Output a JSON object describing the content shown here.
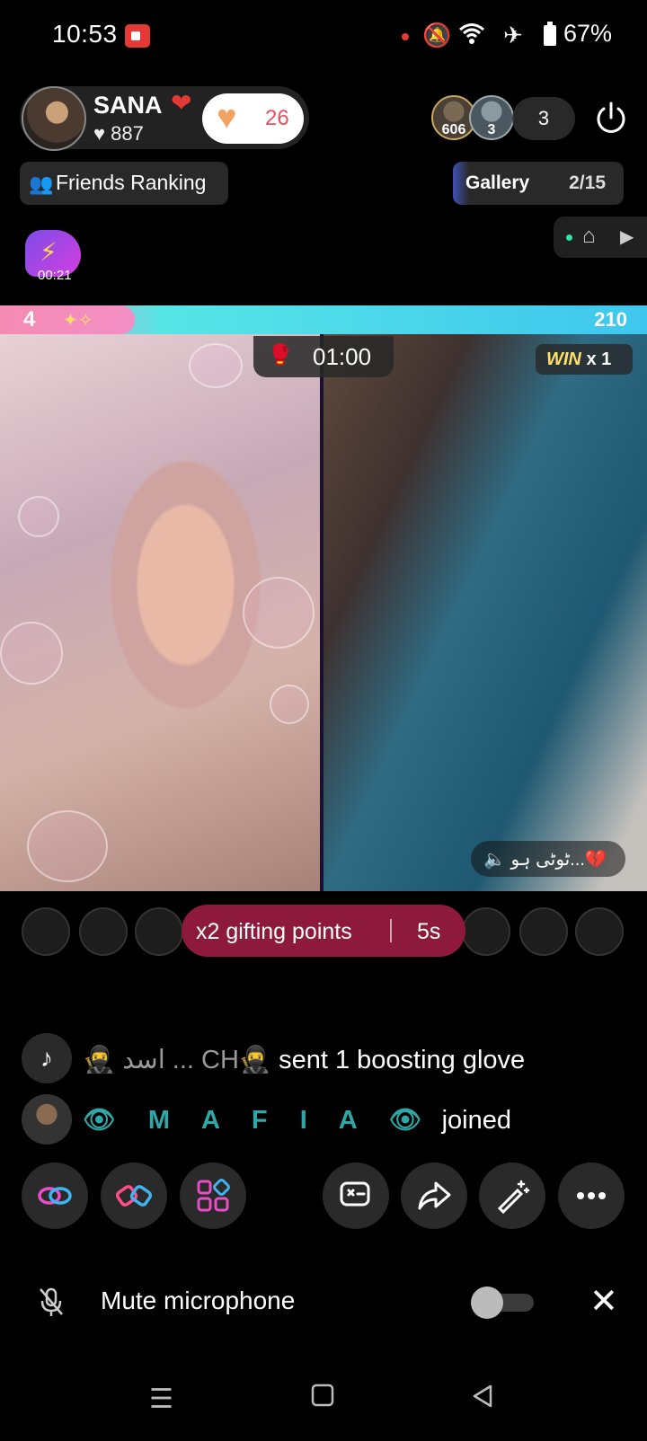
{
  "status_bar": {
    "time": "10:53",
    "battery": "67%"
  },
  "host": {
    "name": "SANA",
    "heart": "❤",
    "likes": "♥ 887",
    "like_count": "26"
  },
  "viewers": {
    "badge1": "606",
    "badge2": "3",
    "count": "3"
  },
  "friends_ranking": {
    "label": "Friends Ranking"
  },
  "gallery": {
    "label": "Gallery",
    "page": "2/15"
  },
  "event": {
    "timer": "00:21"
  },
  "battle": {
    "left_score": "4",
    "right_score": "210",
    "countdown": "01:00",
    "win_label": "WIN",
    "win_count": "x 1"
  },
  "song": {
    "text": "ٹوٹی ہو...💔"
  },
  "gifting": {
    "text": "x2 gifting points",
    "seconds": "5s"
  },
  "chat": [
    {
      "sender": "🥷 اسد ... CH🥷",
      "action": "sent 1 boosting glove"
    },
    {
      "sender": "👁 M A F I A 👁",
      "action": "joined"
    }
  ],
  "mute": {
    "label": "Mute microphone"
  },
  "colors": {
    "accent_pink": "#ee4d5f",
    "gift_banner": "#8d1a3c",
    "battle_blue": "#3fc6ee",
    "battle_pink": "#f58bb2"
  }
}
